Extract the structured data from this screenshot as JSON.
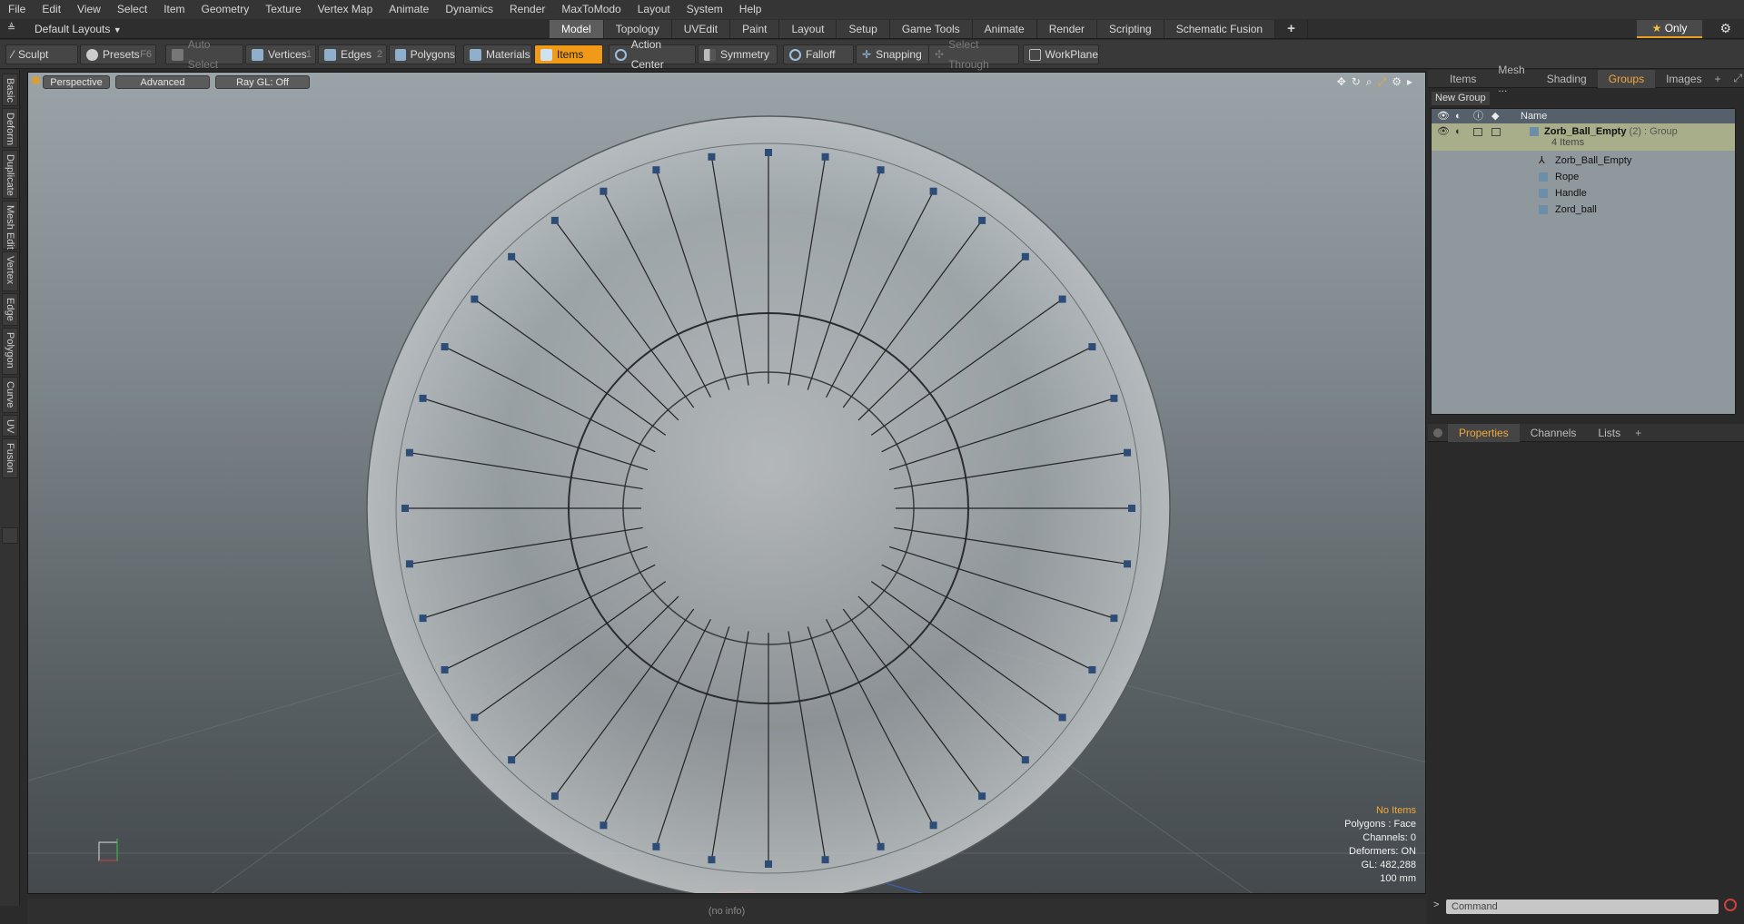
{
  "menu": [
    "File",
    "Edit",
    "View",
    "Select",
    "Item",
    "Geometry",
    "Texture",
    "Vertex Map",
    "Animate",
    "Dynamics",
    "Render",
    "MaxToModo",
    "Layout",
    "System",
    "Help"
  ],
  "layout_selector": "Default Layouts",
  "layout_tabs": [
    "Model",
    "Topology",
    "UVEdit",
    "Paint",
    "Layout",
    "Setup",
    "Game Tools",
    "Animate",
    "Render",
    "Scripting",
    "Schematic Fusion"
  ],
  "active_layout_tab": "Model",
  "only_button": "Only",
  "toolbar": {
    "sculpt": "Sculpt",
    "presets": "Presets",
    "presets_key": "F6",
    "auto_select": "Auto Select",
    "vertices": "Vertices",
    "vertices_key": "1",
    "edges": "Edges",
    "edges_key": "2",
    "polygons": "Polygons",
    "materials": "Materials",
    "items": "Items",
    "action_center": "Action Center",
    "symmetry": "Symmetry",
    "falloff": "Falloff",
    "snapping": "Snapping",
    "select_through": "Select Through",
    "workplane": "WorkPlane"
  },
  "left_tabs": [
    "Basic",
    "Deform",
    "Duplicate",
    "Mesh Edit",
    "Vertex",
    "Edge",
    "Polygon",
    "Curve",
    "UV",
    "Fusion"
  ],
  "viewport": {
    "view_mode": "Perspective",
    "shading": "Advanced",
    "raygl": "Ray GL: Off",
    "hud": {
      "selection": "No Items",
      "polygons": "Polygons : Face",
      "channels": "Channels: 0",
      "deformers": "Deformers: ON",
      "gl": "GL: 482,288",
      "scale": "100 mm"
    }
  },
  "status_text": "(no info)",
  "right_panel": {
    "tabs": [
      "Items",
      "Mesh ...",
      "Shading",
      "Groups",
      "Images"
    ],
    "active_tab": "Groups",
    "new_group": "New Group",
    "column_name": "Name",
    "group": {
      "name": "Zorb_Ball_Empty",
      "count_suffix": "(2)",
      "type": ": Group",
      "items_label": "4 Items",
      "children": [
        "Zorb_Ball_Empty",
        "Rope",
        "Handle",
        "Zord_ball"
      ]
    },
    "bottom_tabs": [
      "Properties",
      "Channels",
      "Lists"
    ],
    "active_bottom_tab": "Properties",
    "command_placeholder": "Command"
  },
  "colors": {
    "accent": "#f19a17",
    "viewport_top": "#9aa3a8",
    "viewport_bottom": "#43494c"
  }
}
